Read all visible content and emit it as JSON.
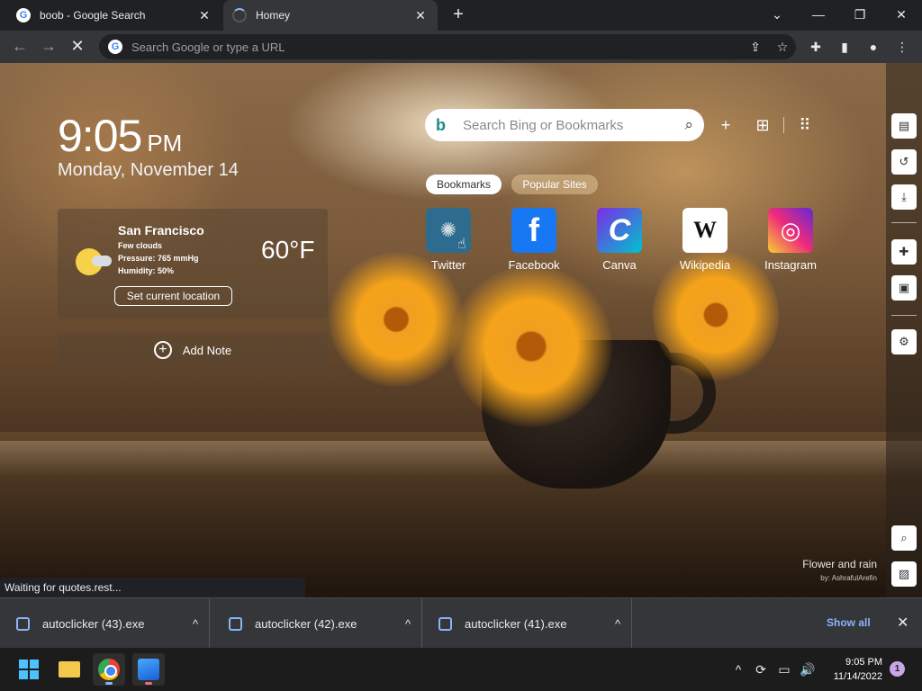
{
  "tabs": [
    {
      "title": "boob - Google Search",
      "favicon": "google-icon",
      "close": "✕"
    },
    {
      "title": "Homey",
      "favicon": "loading-spinner-icon",
      "close": "✕"
    }
  ],
  "window": {
    "new_tab": "+",
    "minimize_glyph": "—",
    "maximize_glyph": "❐",
    "close_glyph": "✕",
    "dropdown_glyph": "⌄"
  },
  "omnibox": {
    "placeholder": "Search Google or type a URL",
    "g": "G"
  },
  "newtab_page": {
    "clock": {
      "time": "9:05",
      "ampm": "PM",
      "date": "Monday, November 14"
    },
    "weather": {
      "city": "San Francisco",
      "condition": "Few clouds",
      "pressure": "Pressure: 765 mmHg",
      "humidity": "Humidity: 50%",
      "temperature": "60°F",
      "location_button": "Set current location"
    },
    "note": {
      "label": "Add Note",
      "plus": "+"
    },
    "search": {
      "placeholder": "Search Bing or Bookmarks",
      "bing_glyph": "b",
      "mag_glyph": "⌕"
    },
    "search_actions": {
      "add": "+",
      "folder": "⊞",
      "apps": "⠿"
    },
    "pills": {
      "bookmarks": "Bookmarks",
      "popular": "Popular Sites"
    },
    "shortcuts": [
      {
        "label": "Twitter",
        "glyph": "✺"
      },
      {
        "label": "Facebook",
        "glyph": "f"
      },
      {
        "label": "Canva",
        "glyph": "C"
      },
      {
        "label": "Wikipedia",
        "glyph": "W"
      },
      {
        "label": "Instagram",
        "glyph": "◎"
      }
    ],
    "photo": {
      "title": "Flower and rain",
      "author": "by: AshrafulArefin"
    }
  },
  "status_text": "Waiting for quotes.rest...",
  "downloads": {
    "items": [
      {
        "name": "autoclicker (43).exe",
        "caret": "^"
      },
      {
        "name": "autoclicker (42).exe",
        "caret": "^"
      },
      {
        "name": "autoclicker (41).exe",
        "caret": "^"
      }
    ],
    "show_all": "Show all",
    "close": "✕"
  },
  "taskbar": {
    "time": "9:05 PM",
    "date": "11/14/2022",
    "notifications": "1",
    "tray_glyphs": {
      "chevron": "^",
      "sync": "⟳",
      "network": "▭",
      "volume": "🔊"
    }
  },
  "colors": {
    "accent": "#8ab4f8",
    "chrome_bg": "#35363a",
    "tab_bg": "#202124"
  }
}
